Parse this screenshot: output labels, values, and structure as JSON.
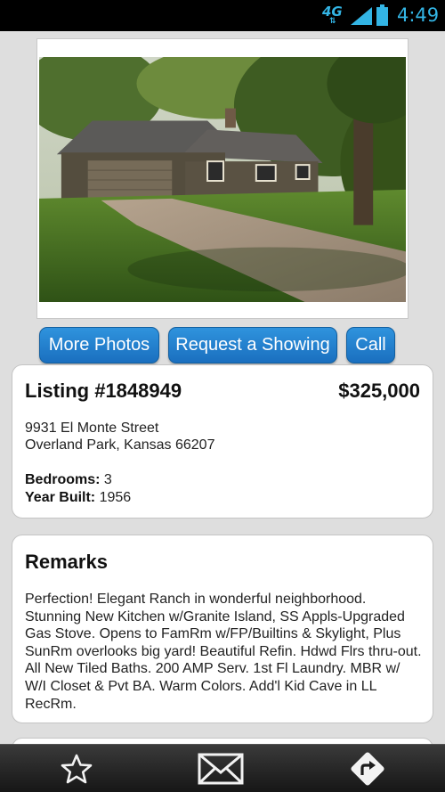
{
  "status_bar": {
    "network": "4G",
    "time": "4:49"
  },
  "actions": {
    "more_photos": "More Photos",
    "request_showing": "Request a Showing",
    "call": "Call"
  },
  "listing": {
    "title": "Listing #1848949",
    "price": "$325,000",
    "address_line1": "9931 El Monte Street",
    "address_line2": "Overland Park, Kansas 66207",
    "bedrooms_label": "Bedrooms:",
    "bedrooms_value": " 3",
    "year_built_label": "Year Built:",
    "year_built_value": " 1956"
  },
  "remarks": {
    "title": "Remarks",
    "text": "Perfection! Elegant Ranch in wonderful neighborhood. Stunning New Kitchen w/Granite Island, SS Appls-Upgraded Gas Stove. Opens to FamRm w/FP/Builtins & Skylight, Plus SunRm overlooks big yard! Beautiful Refin. Hdwd Flrs thru-out. All New Tiled Baths. 200 AMP Serv. 1st Fl Laundry. MBR w/ W/I Closet & Pvt BA. Warm Colors. Add'l Kid Cave in LL RecRm."
  },
  "bottom_bar": {
    "icons": [
      "star-icon",
      "envelope-icon",
      "directions-icon"
    ]
  },
  "colors": {
    "accent_blue": "#2385d3",
    "status_text": "#33b5e5",
    "bottom_bar": "#222222"
  }
}
